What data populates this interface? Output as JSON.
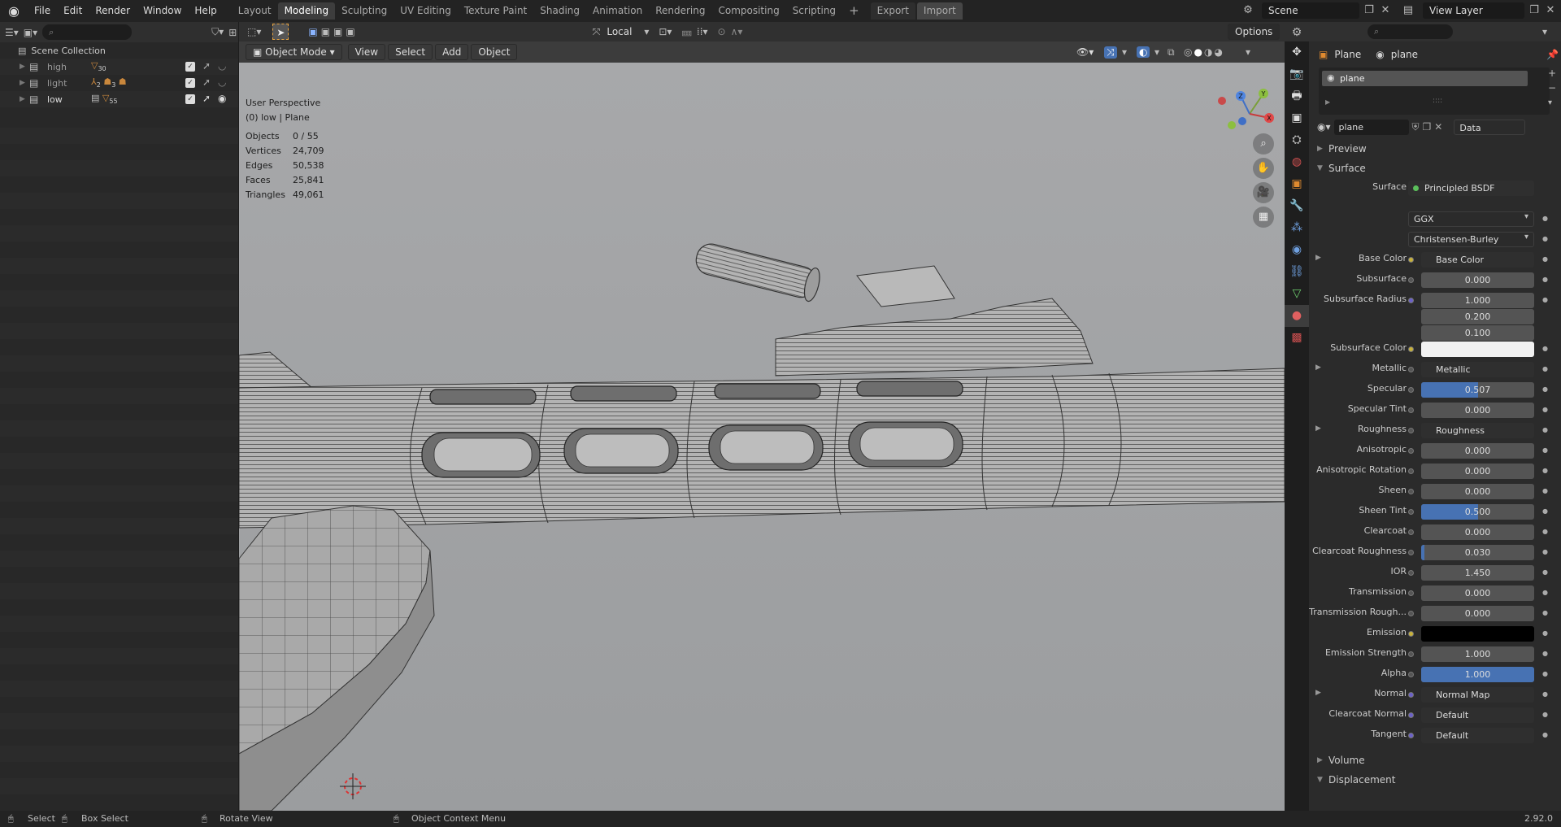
{
  "menu": [
    "File",
    "Edit",
    "Render",
    "Window",
    "Help"
  ],
  "workspaces": [
    "Layout",
    "Modeling",
    "Sculpting",
    "UV Editing",
    "Texture Paint",
    "Shading",
    "Animation",
    "Rendering",
    "Compositing",
    "Scripting"
  ],
  "active_workspace": "Modeling",
  "topbar": {
    "export_label": "Export",
    "import_label": "Import",
    "scene": "Scene",
    "view_layer": "View Layer"
  },
  "outliner": {
    "root": "Scene Collection",
    "rows": [
      {
        "name": "high",
        "badge": "30"
      },
      {
        "name": "light",
        "badge": "2",
        "badge2": "3"
      },
      {
        "name": "low",
        "badge": "55"
      }
    ]
  },
  "viewport": {
    "pivot": "Local",
    "mode": "Object Mode",
    "menus": [
      "View",
      "Select",
      "Add",
      "Object"
    ],
    "options": "Options",
    "perspective": "User Perspective",
    "context": "(0) low | Plane",
    "stats": [
      {
        "k": "Objects",
        "v": "0 / 55"
      },
      {
        "k": "Vertices",
        "v": "24,709"
      },
      {
        "k": "Edges",
        "v": "50,538"
      },
      {
        "k": "Faces",
        "v": "25,841"
      },
      {
        "k": "Triangles",
        "v": "49,061"
      }
    ],
    "gizmo": {
      "x": "X",
      "y": "Y",
      "z": "Z"
    }
  },
  "properties": {
    "breadcrumb_object": "Plane",
    "breadcrumb_material": "plane",
    "material_slot": "plane",
    "material_name": "plane",
    "link": "Data",
    "sections": {
      "preview": "Preview",
      "surface": "Surface",
      "volume": "Volume",
      "displacement": "Displacement"
    },
    "surface_label": "Surface",
    "surface_shader": "Principled BSDF",
    "distribution": "GGX",
    "subsurface_method": "Christensen-Burley",
    "rows": [
      {
        "label": "Base Color",
        "kind": "link",
        "value": "Base Color",
        "dot": "#c8b23c",
        "expand": true
      },
      {
        "label": "Subsurface",
        "kind": "val",
        "value": "0.000"
      },
      {
        "label": "Subsurface Radius",
        "kind": "val",
        "value": "1.000",
        "dot": "#6c62c8"
      },
      {
        "label": "",
        "kind": "val",
        "value": "0.200",
        "nodot": true
      },
      {
        "label": "",
        "kind": "val",
        "value": "0.100",
        "nodot": true
      },
      {
        "label": "Subsurface Color",
        "kind": "color",
        "color": "#f2f2f2",
        "dot": "#c8b23c"
      },
      {
        "label": "Metallic",
        "kind": "link",
        "value": "Metallic",
        "expand": true
      },
      {
        "label": "Specular",
        "kind": "val",
        "value": "0.507",
        "fill": 0.507
      },
      {
        "label": "Specular Tint",
        "kind": "val",
        "value": "0.000"
      },
      {
        "label": "Roughness",
        "kind": "link",
        "value": "Roughness",
        "expand": true
      },
      {
        "label": "Anisotropic",
        "kind": "val",
        "value": "0.000"
      },
      {
        "label": "Anisotropic Rotation",
        "kind": "val",
        "value": "0.000"
      },
      {
        "label": "Sheen",
        "kind": "val",
        "value": "0.000"
      },
      {
        "label": "Sheen Tint",
        "kind": "val",
        "value": "0.500",
        "fill": 0.5
      },
      {
        "label": "Clearcoat",
        "kind": "val",
        "value": "0.000"
      },
      {
        "label": "Clearcoat Roughness",
        "kind": "val",
        "value": "0.030",
        "fill": 0.03
      },
      {
        "label": "IOR",
        "kind": "val",
        "value": "1.450"
      },
      {
        "label": "Transmission",
        "kind": "val",
        "value": "0.000"
      },
      {
        "label": "Transmission Rough...",
        "kind": "val",
        "value": "0.000"
      },
      {
        "label": "Emission",
        "kind": "color",
        "color": "#000000",
        "dot": "#c8b23c"
      },
      {
        "label": "Emission Strength",
        "kind": "val",
        "value": "1.000"
      },
      {
        "label": "Alpha",
        "kind": "val",
        "value": "1.000",
        "fill": 1.0
      },
      {
        "label": "Normal",
        "kind": "link",
        "value": "Normal Map",
        "dot": "#6c62c8",
        "expand": true
      },
      {
        "label": "Clearcoat Normal",
        "kind": "link",
        "value": "Default",
        "dot": "#6c62c8"
      },
      {
        "label": "Tangent",
        "kind": "link",
        "value": "Default",
        "dot": "#6c62c8"
      }
    ]
  },
  "statusbar": {
    "select": "Select",
    "box_select": "Box Select",
    "rotate": "Rotate View",
    "context_menu": "Object Context Menu",
    "version": "2.92.0"
  }
}
